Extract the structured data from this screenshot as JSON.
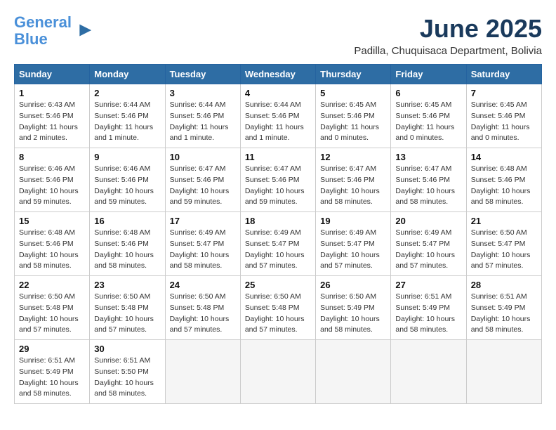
{
  "logo": {
    "line1": "General",
    "line2": "Blue"
  },
  "title": "June 2025",
  "subtitle": "Padilla, Chuquisaca Department, Bolivia",
  "weekdays": [
    "Sunday",
    "Monday",
    "Tuesday",
    "Wednesday",
    "Thursday",
    "Friday",
    "Saturday"
  ],
  "weeks": [
    [
      {
        "day": "1",
        "sunrise": "Sunrise: 6:43 AM",
        "sunset": "Sunset: 5:46 PM",
        "daylight": "Daylight: 11 hours and 2 minutes."
      },
      {
        "day": "2",
        "sunrise": "Sunrise: 6:44 AM",
        "sunset": "Sunset: 5:46 PM",
        "daylight": "Daylight: 11 hours and 1 minute."
      },
      {
        "day": "3",
        "sunrise": "Sunrise: 6:44 AM",
        "sunset": "Sunset: 5:46 PM",
        "daylight": "Daylight: 11 hours and 1 minute."
      },
      {
        "day": "4",
        "sunrise": "Sunrise: 6:44 AM",
        "sunset": "Sunset: 5:46 PM",
        "daylight": "Daylight: 11 hours and 1 minute."
      },
      {
        "day": "5",
        "sunrise": "Sunrise: 6:45 AM",
        "sunset": "Sunset: 5:46 PM",
        "daylight": "Daylight: 11 hours and 0 minutes."
      },
      {
        "day": "6",
        "sunrise": "Sunrise: 6:45 AM",
        "sunset": "Sunset: 5:46 PM",
        "daylight": "Daylight: 11 hours and 0 minutes."
      },
      {
        "day": "7",
        "sunrise": "Sunrise: 6:45 AM",
        "sunset": "Sunset: 5:46 PM",
        "daylight": "Daylight: 11 hours and 0 minutes."
      }
    ],
    [
      {
        "day": "8",
        "sunrise": "Sunrise: 6:46 AM",
        "sunset": "Sunset: 5:46 PM",
        "daylight": "Daylight: 10 hours and 59 minutes."
      },
      {
        "day": "9",
        "sunrise": "Sunrise: 6:46 AM",
        "sunset": "Sunset: 5:46 PM",
        "daylight": "Daylight: 10 hours and 59 minutes."
      },
      {
        "day": "10",
        "sunrise": "Sunrise: 6:47 AM",
        "sunset": "Sunset: 5:46 PM",
        "daylight": "Daylight: 10 hours and 59 minutes."
      },
      {
        "day": "11",
        "sunrise": "Sunrise: 6:47 AM",
        "sunset": "Sunset: 5:46 PM",
        "daylight": "Daylight: 10 hours and 59 minutes."
      },
      {
        "day": "12",
        "sunrise": "Sunrise: 6:47 AM",
        "sunset": "Sunset: 5:46 PM",
        "daylight": "Daylight: 10 hours and 58 minutes."
      },
      {
        "day": "13",
        "sunrise": "Sunrise: 6:47 AM",
        "sunset": "Sunset: 5:46 PM",
        "daylight": "Daylight: 10 hours and 58 minutes."
      },
      {
        "day": "14",
        "sunrise": "Sunrise: 6:48 AM",
        "sunset": "Sunset: 5:46 PM",
        "daylight": "Daylight: 10 hours and 58 minutes."
      }
    ],
    [
      {
        "day": "15",
        "sunrise": "Sunrise: 6:48 AM",
        "sunset": "Sunset: 5:46 PM",
        "daylight": "Daylight: 10 hours and 58 minutes."
      },
      {
        "day": "16",
        "sunrise": "Sunrise: 6:48 AM",
        "sunset": "Sunset: 5:46 PM",
        "daylight": "Daylight: 10 hours and 58 minutes."
      },
      {
        "day": "17",
        "sunrise": "Sunrise: 6:49 AM",
        "sunset": "Sunset: 5:47 PM",
        "daylight": "Daylight: 10 hours and 58 minutes."
      },
      {
        "day": "18",
        "sunrise": "Sunrise: 6:49 AM",
        "sunset": "Sunset: 5:47 PM",
        "daylight": "Daylight: 10 hours and 57 minutes."
      },
      {
        "day": "19",
        "sunrise": "Sunrise: 6:49 AM",
        "sunset": "Sunset: 5:47 PM",
        "daylight": "Daylight: 10 hours and 57 minutes."
      },
      {
        "day": "20",
        "sunrise": "Sunrise: 6:49 AM",
        "sunset": "Sunset: 5:47 PM",
        "daylight": "Daylight: 10 hours and 57 minutes."
      },
      {
        "day": "21",
        "sunrise": "Sunrise: 6:50 AM",
        "sunset": "Sunset: 5:47 PM",
        "daylight": "Daylight: 10 hours and 57 minutes."
      }
    ],
    [
      {
        "day": "22",
        "sunrise": "Sunrise: 6:50 AM",
        "sunset": "Sunset: 5:48 PM",
        "daylight": "Daylight: 10 hours and 57 minutes."
      },
      {
        "day": "23",
        "sunrise": "Sunrise: 6:50 AM",
        "sunset": "Sunset: 5:48 PM",
        "daylight": "Daylight: 10 hours and 57 minutes."
      },
      {
        "day": "24",
        "sunrise": "Sunrise: 6:50 AM",
        "sunset": "Sunset: 5:48 PM",
        "daylight": "Daylight: 10 hours and 57 minutes."
      },
      {
        "day": "25",
        "sunrise": "Sunrise: 6:50 AM",
        "sunset": "Sunset: 5:48 PM",
        "daylight": "Daylight: 10 hours and 57 minutes."
      },
      {
        "day": "26",
        "sunrise": "Sunrise: 6:50 AM",
        "sunset": "Sunset: 5:49 PM",
        "daylight": "Daylight: 10 hours and 58 minutes."
      },
      {
        "day": "27",
        "sunrise": "Sunrise: 6:51 AM",
        "sunset": "Sunset: 5:49 PM",
        "daylight": "Daylight: 10 hours and 58 minutes."
      },
      {
        "day": "28",
        "sunrise": "Sunrise: 6:51 AM",
        "sunset": "Sunset: 5:49 PM",
        "daylight": "Daylight: 10 hours and 58 minutes."
      }
    ],
    [
      {
        "day": "29",
        "sunrise": "Sunrise: 6:51 AM",
        "sunset": "Sunset: 5:49 PM",
        "daylight": "Daylight: 10 hours and 58 minutes."
      },
      {
        "day": "30",
        "sunrise": "Sunrise: 6:51 AM",
        "sunset": "Sunset: 5:50 PM",
        "daylight": "Daylight: 10 hours and 58 minutes."
      },
      null,
      null,
      null,
      null,
      null
    ]
  ]
}
